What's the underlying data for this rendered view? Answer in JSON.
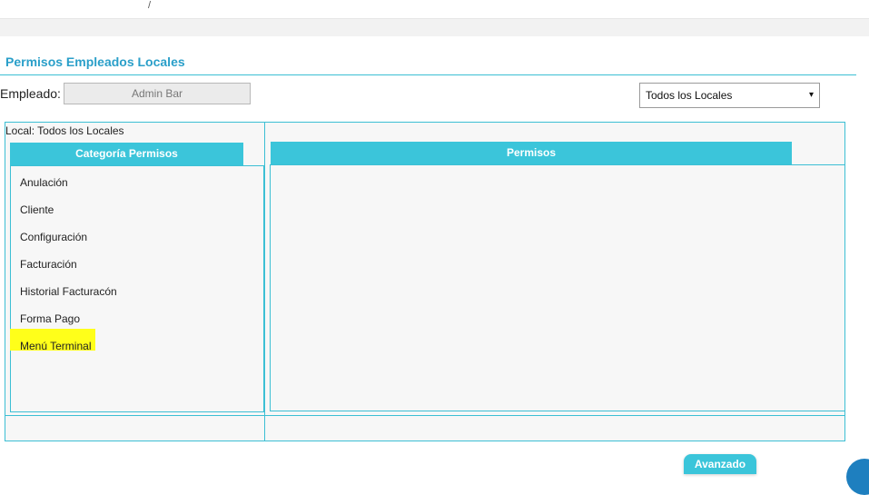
{
  "header": {
    "tick": "/"
  },
  "section": {
    "title": "Permisos Empleados Locales"
  },
  "employee": {
    "label": "Empleado:",
    "value": "Admin Bar"
  },
  "local_select": {
    "selected": "Todos los Locales",
    "caret": "▾"
  },
  "local_label": "Local: Todos los Locales",
  "categories": {
    "header": "Categoría Permisos",
    "items": [
      "Anulación",
      "Cliente",
      "Configuración",
      "Facturación",
      "Historial Facturacón",
      "Forma Pago",
      "Menú Terminal"
    ],
    "highlighted_index": 6,
    "highlight_color": "#ffff1a"
  },
  "permissions": {
    "header": "Permisos"
  },
  "buttons": {
    "advanced": "Avanzado"
  },
  "colors": {
    "accent": "#3bc5da",
    "title": "#2a9fc9"
  }
}
